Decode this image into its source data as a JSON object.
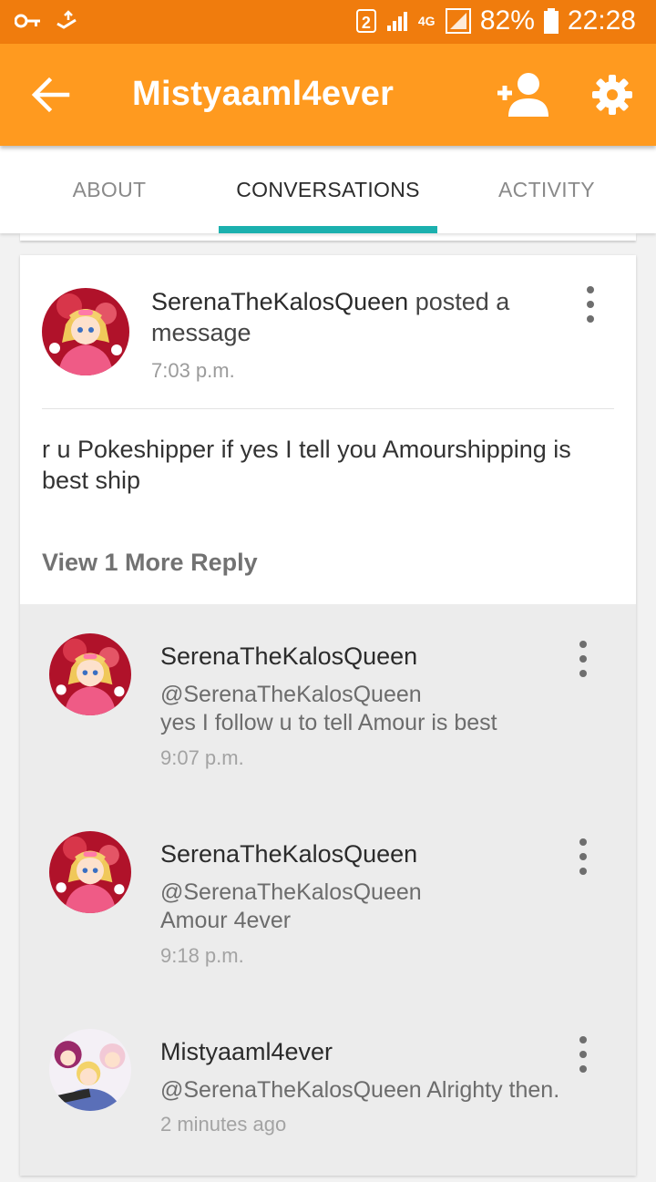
{
  "status_bar": {
    "sim_slot": "2",
    "network": "4G",
    "battery": "82%",
    "time": "22:28",
    "icons": [
      "key-icon",
      "usb-debug-icon",
      "signal-icon",
      "battery-icon"
    ]
  },
  "app_bar": {
    "title": "Mistyaaml4ever",
    "background": "#ff9a1f",
    "icons": [
      "back-arrow-icon",
      "add-user-icon",
      "gear-icon"
    ]
  },
  "tabs": {
    "items": [
      "ABOUT",
      "CONVERSATIONS",
      "ACTIVITY"
    ],
    "selected": "CONVERSATIONS",
    "indicator_color": "#1bb0ae"
  },
  "post": {
    "author": "SerenaTheKalosQueen",
    "action": "posted a message",
    "time": "7:03 p.m.",
    "body": "r u Pokeshipper if yes I tell you Amourshipping is best ship",
    "view_more": "View 1 More Reply"
  },
  "replies": [
    {
      "author": "SerenaTheKalosQueen",
      "mention": "@SerenaTheKalosQueen",
      "text": "yes I follow u to tell Amour is best",
      "time": "9:07 p.m."
    },
    {
      "author": "SerenaTheKalosQueen",
      "mention": "@SerenaTheKalosQueen",
      "text": "Amour 4ever",
      "time": "9:18 p.m."
    },
    {
      "author": "Mistyaaml4ever",
      "mention": "@SerenaTheKalosQueen",
      "text": "Alrighty then.",
      "time": "2 minutes ago"
    }
  ]
}
